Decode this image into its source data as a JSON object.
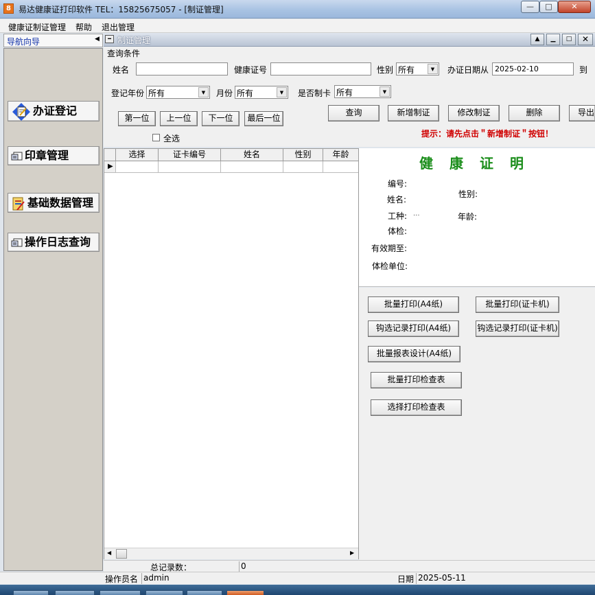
{
  "window": {
    "app_icon_text": "8",
    "title": "易达健康证打印软件  TEL：15825675057  - [制证管理]",
    "min_glyph": "—",
    "max_glyph": "□",
    "close_glyph": "✕"
  },
  "menubar": [
    "健康证制证管理",
    "帮助",
    "退出管理"
  ],
  "nav": {
    "title": "导航向导",
    "items": [
      "办证登记",
      "印章管理",
      "基础数据管理",
      "操作日志查询"
    ]
  },
  "content_window": {
    "title": "制证管理"
  },
  "query": {
    "group_label": "查询条件",
    "name_label": "姓名",
    "name_value": "",
    "cert_no_label": "健康证号",
    "cert_no_value": "",
    "gender_label": "性别",
    "gender_value": "所有",
    "issue_date_from_label": "办证日期从",
    "issue_date_from_value": "2025-02-10",
    "issue_date_to_label": "到",
    "reg_year_label": "登记年份",
    "reg_year_value": "所有",
    "month_label": "月份",
    "month_value": "所有",
    "made_label": "是否制卡",
    "made_value": "所有",
    "nav_first": "第一位",
    "nav_prev": "上一位",
    "nav_next": "下一位",
    "nav_last": "最后一位",
    "select_all": "全选",
    "btn_query": "查询",
    "btn_add": "新增制证",
    "btn_edit": "修改制证",
    "btn_delete": "删除",
    "btn_export": "导出",
    "hint": "提示：请先点击＂新增制证＂按钮！"
  },
  "grid": {
    "columns": [
      "选择",
      "证卡编号",
      "姓名",
      "性别",
      "年龄"
    ],
    "rows": [
      [
        "",
        "",
        "",
        "",
        ""
      ]
    ]
  },
  "certificate": {
    "title": "健康证明",
    "number_label": "编号:",
    "name_label": "姓名:",
    "gender_label": "性别:",
    "job_label": "工种:",
    "job_value": "...",
    "age_label": "年龄:",
    "exam_label": "体检:",
    "valid_until_label": "有效期至:",
    "exam_unit_label": "体检单位:"
  },
  "print_buttons": {
    "batch_a4": "批量打印(A4纸)",
    "batch_card": "批量打印(证卡机)",
    "checked_a4": "钩选记录打印(A4纸)",
    "checked_card": "钩选记录打印(证卡机)",
    "batch_report_design": "批量报表设计(A4纸)",
    "batch_exam_sheet": "批量打印检查表",
    "select_exam_sheet": "选择打印检查表"
  },
  "records": {
    "label": "总记录数：",
    "value": "0"
  },
  "status": {
    "operator_label": "操作员名",
    "operator_value": "admin",
    "date_label": "日期",
    "date_value": "2025-05-11"
  }
}
